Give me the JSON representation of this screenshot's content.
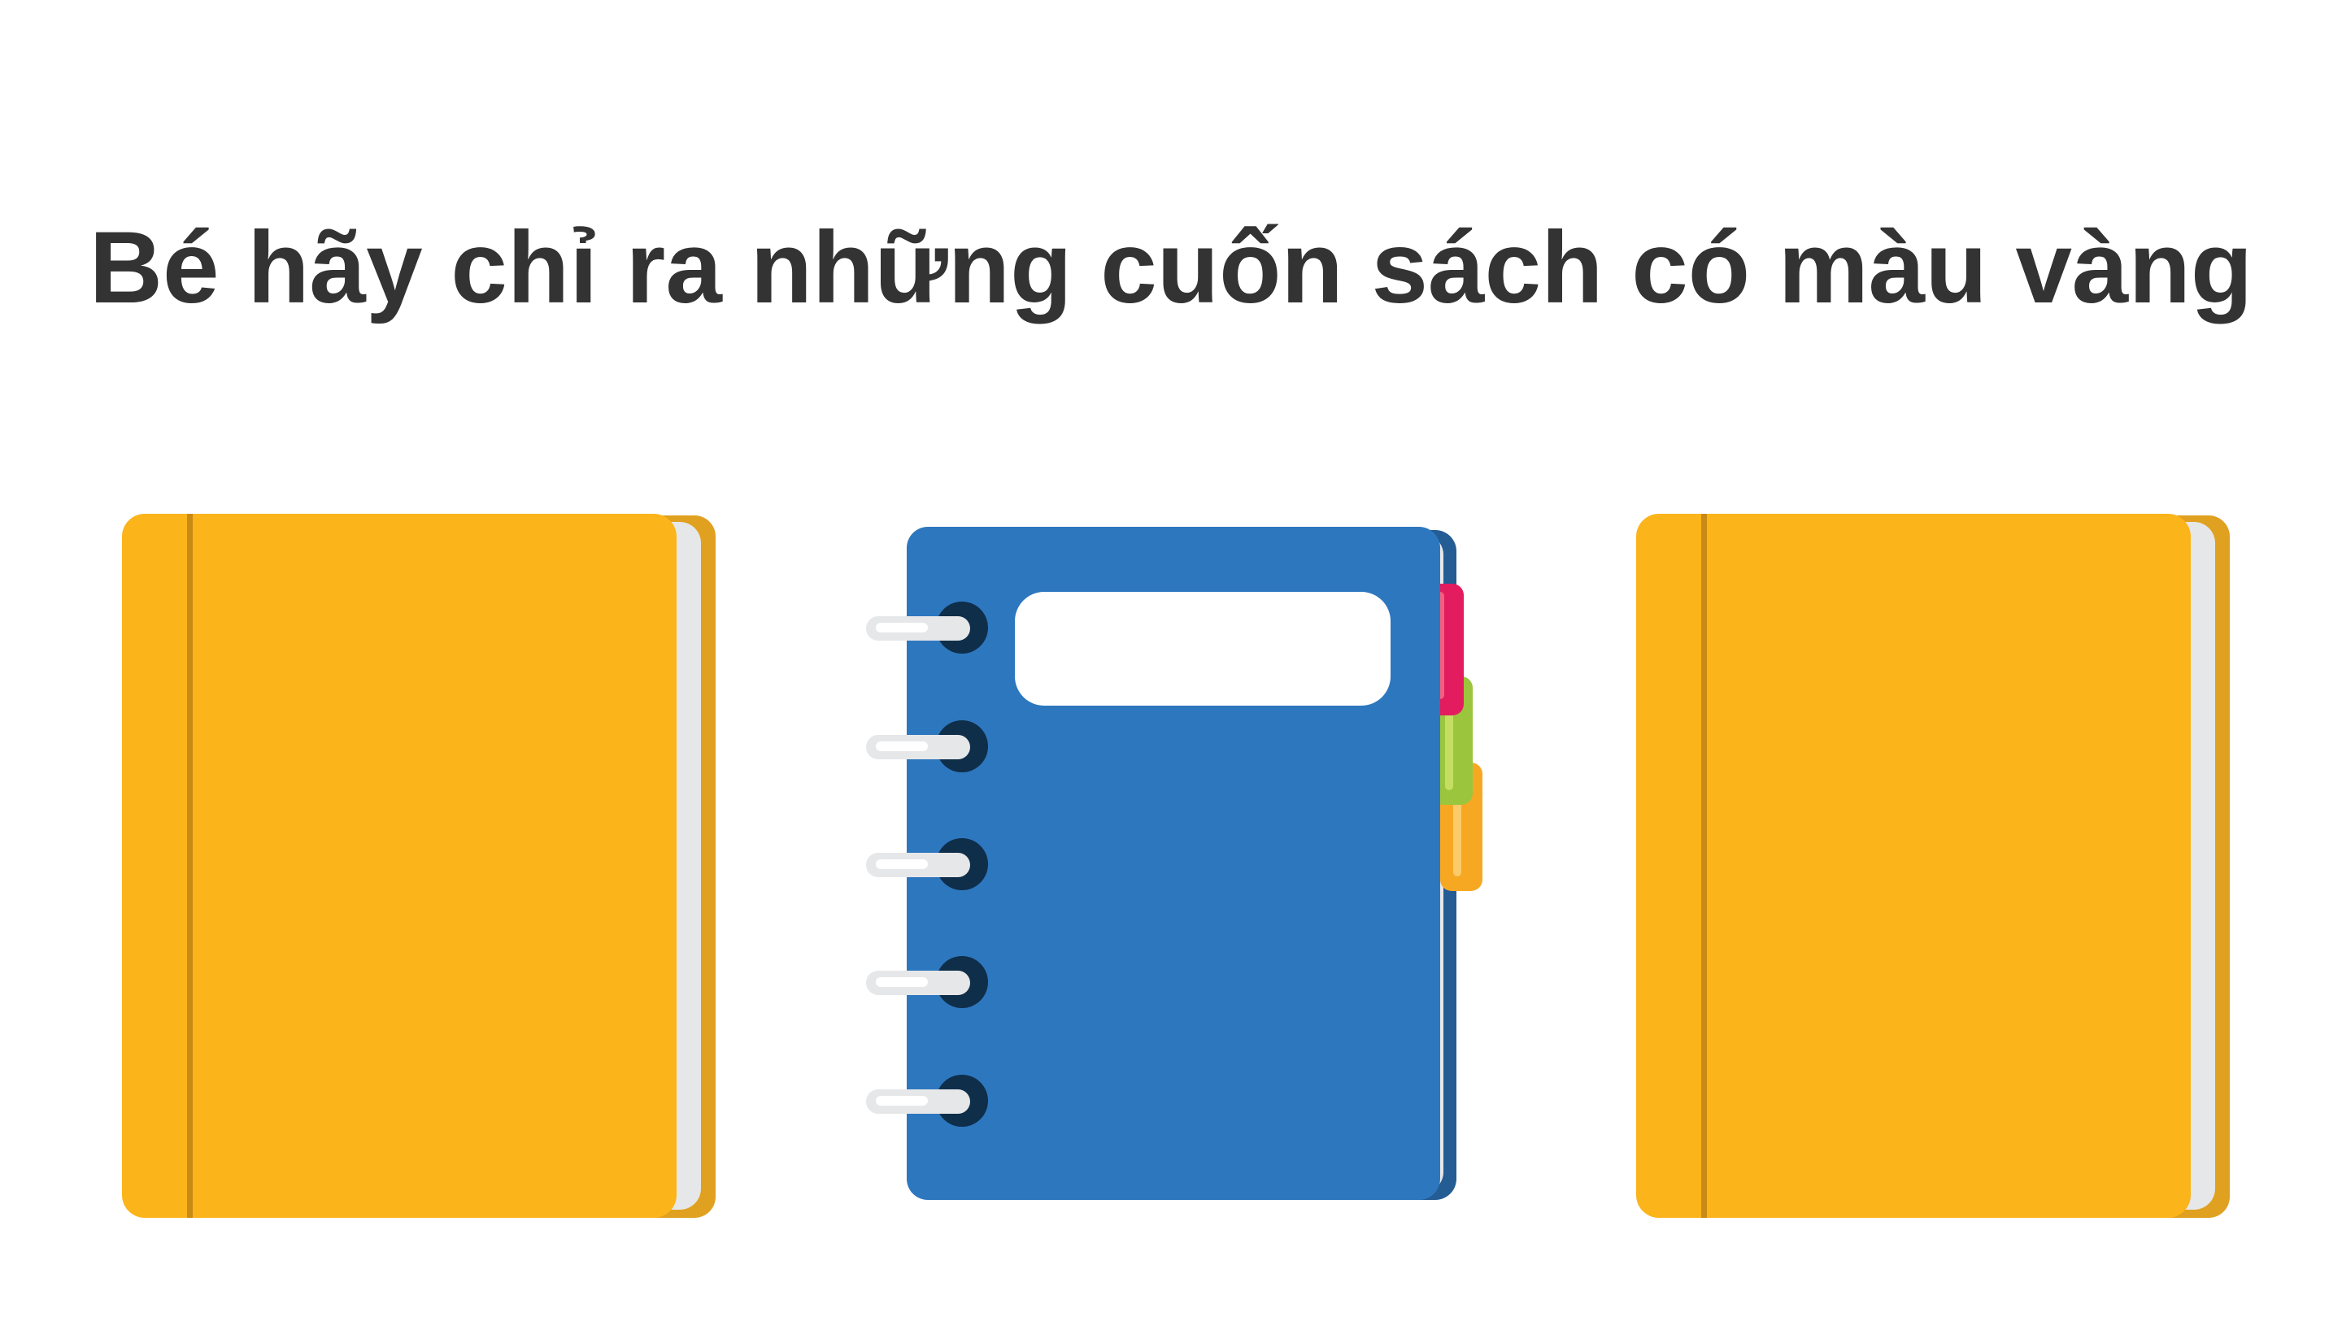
{
  "title": "Bé hãy chỉ ra những cuốn sách có màu vàng",
  "books": [
    {
      "name": "yellow-book",
      "color": "#FBB41A"
    },
    {
      "name": "blue-spiral-notebook",
      "color": "#2D77BF"
    },
    {
      "name": "yellow-book",
      "color": "#FBB41A"
    }
  ],
  "colors": {
    "title_text": "#333333",
    "yellow_cover": "#FBB41A",
    "yellow_back": "#E0A020",
    "yellow_spine_line": "#C88A14",
    "blue_cover": "#2D77BF",
    "blue_back": "#245C94",
    "pages": "#E6E7E9",
    "ring_hole": "#0F2E4A",
    "tab_red": "#E31C5F",
    "tab_green": "#9BC53D",
    "tab_orange": "#F7A823"
  }
}
